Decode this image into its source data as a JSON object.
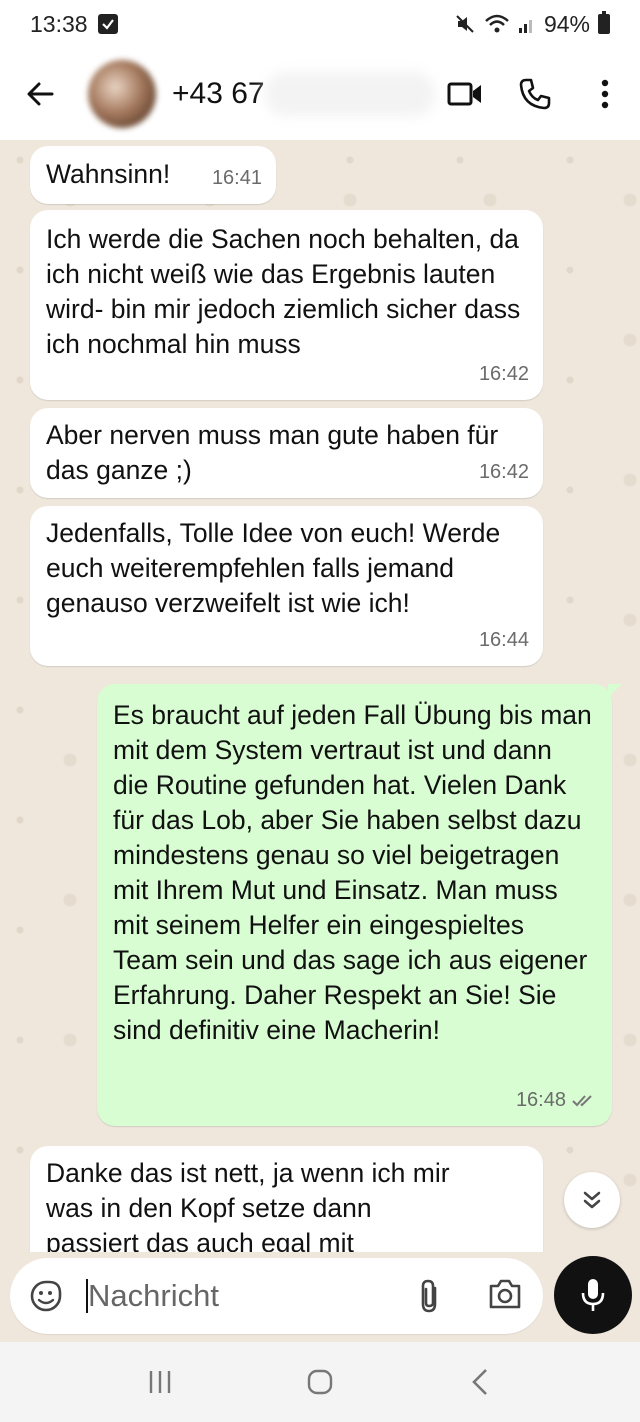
{
  "status_bar": {
    "time": "13:38",
    "battery": "94%"
  },
  "header": {
    "contact_name": "+43 67"
  },
  "messages": [
    {
      "direction": "in",
      "text": "Wahnsinn!",
      "time": "16:41"
    },
    {
      "direction": "in",
      "text": "Ich werde die Sachen noch behalten, da ich nicht weiß wie das Ergebnis lauten wird- bin mir jedoch ziemlich sicher dass ich nochmal hin muss",
      "time": "16:42"
    },
    {
      "direction": "in",
      "text": "Aber nerven muss man gute haben für das ganze ;)",
      "time": "16:42"
    },
    {
      "direction": "in",
      "text": "Jedenfalls, Tolle Idee von euch! Werde euch weiterempfehlen falls jemand genauso verzweifelt ist wie ich!",
      "time": "16:44"
    },
    {
      "direction": "out",
      "text": "Es braucht auf jeden Fall Übung bis man mit dem System vertraut ist und dann die Routine gefunden hat. Vielen Dank für das Lob, aber Sie haben selbst dazu mindestens genau so viel beigetragen mit Ihrem Mut und Einsatz. Man muss mit seinem Helfer ein eingespieltes Team sein und das sage ich aus eigener Erfahrung. Daher Respekt an Sie! Sie sind definitiv eine Macherin!",
      "time": "16:48",
      "status": "read"
    },
    {
      "direction": "in",
      "text": "Danke das ist nett, ja wenn ich mir was in den Kopf setze dann passiert das auch egal mit welchen"
    }
  ],
  "composer": {
    "placeholder": "Nachricht"
  },
  "icons": {
    "back": "arrow-left-icon",
    "video": "video-call-icon",
    "call": "phone-icon",
    "menu": "more-vertical-icon",
    "emoji": "sticker-icon",
    "attach": "paperclip-icon",
    "camera": "camera-icon",
    "mic": "microphone-icon",
    "scroll": "double-chevron-down-icon"
  },
  "colors": {
    "incoming_bubble": "#ffffff",
    "outgoing_bubble": "#d8fdd2",
    "wallpaper": "#efe7dc",
    "mic_button": "#111111"
  }
}
